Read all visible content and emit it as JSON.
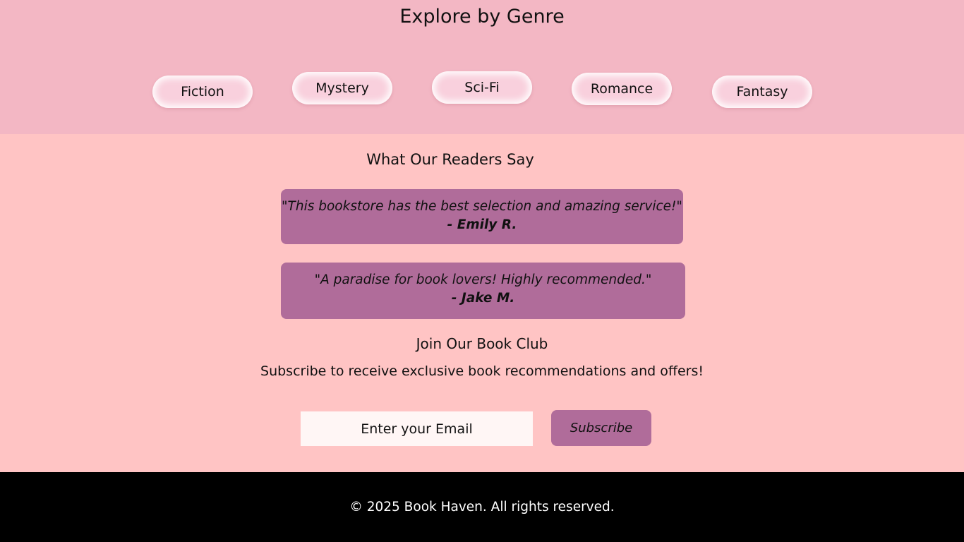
{
  "genres": {
    "title": "Explore by Genre",
    "items": [
      {
        "label": "Fiction"
      },
      {
        "label": "Mystery"
      },
      {
        "label": "Sci-Fi"
      },
      {
        "label": "Romance"
      },
      {
        "label": "Fantasy"
      }
    ]
  },
  "testimonials": {
    "title": "What Our Readers Say",
    "items": [
      {
        "quote": "\"This bookstore has the best selection and amazing service!\"",
        "author": "- Emily R."
      },
      {
        "quote": "\"A paradise for book lovers! Highly recommended.\"",
        "author": "- Jake M."
      }
    ]
  },
  "book_club": {
    "title": "Join Our Book Club",
    "description": "Subscribe to receive exclusive book recommendations and offers!",
    "email_placeholder": "Enter your Email",
    "email_value": "",
    "subscribe_label": "Subscribe"
  },
  "footer": {
    "copyright": "© 2025 Book Haven. All rights reserved."
  },
  "colors": {
    "genre_background": "#f3b7c4",
    "genre_button": "#f9d0dd",
    "reviews_background": "#ffc4c4",
    "accent": "#b06c9a",
    "footer_background": "#000000"
  }
}
